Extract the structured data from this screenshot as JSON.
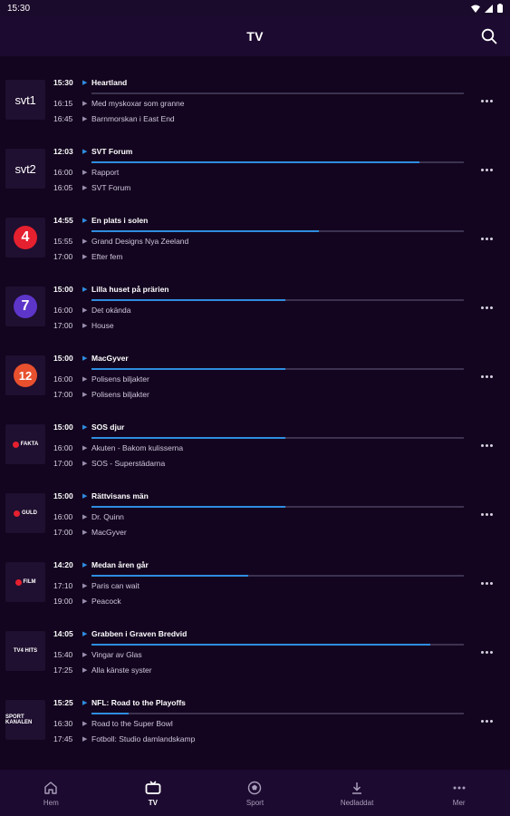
{
  "status": {
    "time": "15:30"
  },
  "header": {
    "title": "TV"
  },
  "colors": {
    "accent": "#2f8de0",
    "background": "#13051f",
    "bar_bg": "#1d0a30"
  },
  "channels": [
    {
      "logo": "svt1",
      "logo_text": "svt1",
      "progress": 0.0,
      "programs": [
        {
          "time": "15:30",
          "title": "Heartland"
        },
        {
          "time": "16:15",
          "title": "Med myskoxar som granne"
        },
        {
          "time": "16:45",
          "title": "Barnmorskan i East End"
        }
      ]
    },
    {
      "logo": "svt2",
      "logo_text": "svt2",
      "progress": 0.88,
      "programs": [
        {
          "time": "12:03",
          "title": "SVT Forum"
        },
        {
          "time": "16:00",
          "title": "Rapport"
        },
        {
          "time": "16:05",
          "title": "SVT Forum"
        }
      ]
    },
    {
      "logo": "tv4",
      "logo_text": "4",
      "logo_color": "#e5202f",
      "progress": 0.61,
      "programs": [
        {
          "time": "14:55",
          "title": "En plats i solen"
        },
        {
          "time": "15:55",
          "title": "Grand Designs Nya Zeeland"
        },
        {
          "time": "17:00",
          "title": "Efter fem"
        }
      ]
    },
    {
      "logo": "tv7",
      "logo_text": "7",
      "logo_color": "#5d35c9",
      "progress": 0.52,
      "programs": [
        {
          "time": "15:00",
          "title": "Lilla huset på prärien"
        },
        {
          "time": "16:00",
          "title": "Det okända"
        },
        {
          "time": "17:00",
          "title": "House"
        }
      ]
    },
    {
      "logo": "tv12",
      "logo_text": "12",
      "logo_color": "#e8502e",
      "progress": 0.52,
      "programs": [
        {
          "time": "15:00",
          "title": "MacGyver"
        },
        {
          "time": "16:00",
          "title": "Polisens biljakter"
        },
        {
          "time": "17:00",
          "title": "Polisens biljakter"
        }
      ]
    },
    {
      "logo": "tv4-fakta",
      "logo_text": "FAKTA",
      "progress": 0.52,
      "programs": [
        {
          "time": "15:00",
          "title": "SOS djur"
        },
        {
          "time": "16:00",
          "title": "Akuten - Bakom kulisserna"
        },
        {
          "time": "17:00",
          "title": "SOS - Superstädarna"
        }
      ]
    },
    {
      "logo": "tv4-guld",
      "logo_text": "GULD",
      "progress": 0.52,
      "programs": [
        {
          "time": "15:00",
          "title": "Rättvisans män"
        },
        {
          "time": "16:00",
          "title": "Dr. Quinn"
        },
        {
          "time": "17:00",
          "title": "MacGyver"
        }
      ]
    },
    {
      "logo": "tv4-film",
      "logo_text": "FILM",
      "progress": 0.42,
      "programs": [
        {
          "time": "14:20",
          "title": "Medan åren går"
        },
        {
          "time": "17:10",
          "title": "Paris can wait"
        },
        {
          "time": "19:00",
          "title": "Peacock"
        }
      ]
    },
    {
      "logo": "tv4-hits",
      "logo_text": "TV4 HITS",
      "progress": 0.91,
      "programs": [
        {
          "time": "14:05",
          "title": "Grabben i Graven Bredvid"
        },
        {
          "time": "15:40",
          "title": "Vingar av Glas"
        },
        {
          "time": "17:25",
          "title": "Alla känste syster"
        }
      ]
    },
    {
      "logo": "sportkanalen",
      "logo_text": "SPORT KANALEN",
      "progress": 0.1,
      "programs": [
        {
          "time": "15:25",
          "title": "NFL: Road to the Playoffs"
        },
        {
          "time": "16:30",
          "title": "Road to the Super Bowl"
        },
        {
          "time": "17:45",
          "title": "Fotboll: Studio damlandskamp"
        }
      ]
    }
  ],
  "nav": [
    {
      "label": "Hem",
      "icon": "home-icon",
      "active": false
    },
    {
      "label": "TV",
      "icon": "tv-icon",
      "active": true
    },
    {
      "label": "Sport",
      "icon": "ball-icon",
      "active": false
    },
    {
      "label": "Nedladdat",
      "icon": "download-icon",
      "active": false
    },
    {
      "label": "Mer",
      "icon": "more-icon",
      "active": false
    }
  ]
}
